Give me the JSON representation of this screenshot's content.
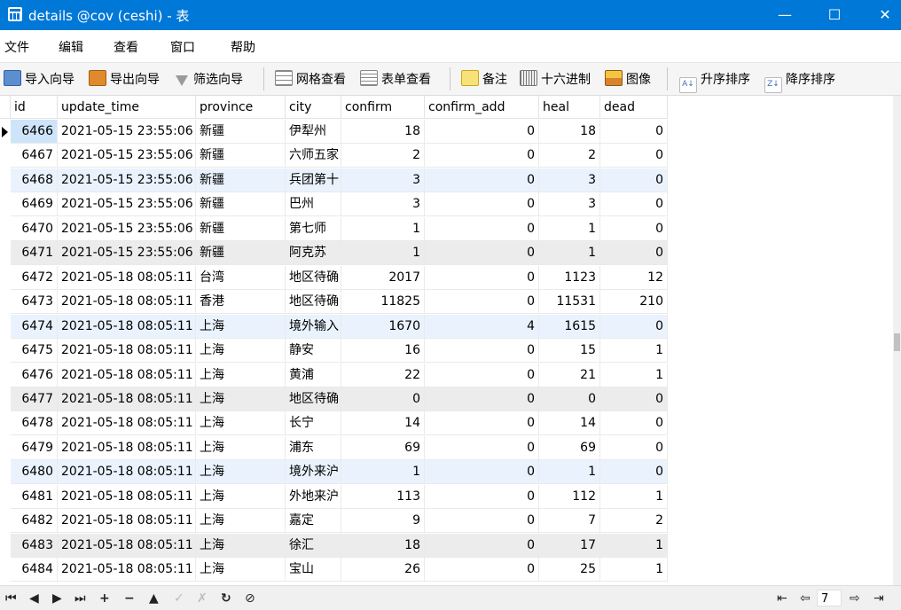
{
  "window": {
    "title": "details @cov (ceshi) - 表",
    "minimize": "—",
    "maximize": "☐",
    "close": "✕"
  },
  "menu": [
    "文件",
    "编辑",
    "查看",
    "窗口",
    "帮助"
  ],
  "toolbar": {
    "import_wizard": "导入向导",
    "export_wizard": "导出向导",
    "filter_wizard": "筛选向导",
    "grid_view": "网格查看",
    "form_view": "表单查看",
    "memo": "备注",
    "hex": "十六进制",
    "image": "图像",
    "sort_asc": "升序排序",
    "sort_desc": "降序排序"
  },
  "table": {
    "columns": [
      "id",
      "update_time",
      "province",
      "city",
      "confirm",
      "confirm_add",
      "heal",
      "dead"
    ],
    "rows": [
      [
        "6466",
        "2021-05-15 23:55:06",
        "新疆",
        "伊犁州",
        "18",
        "0",
        "18",
        "0"
      ],
      [
        "6467",
        "2021-05-15 23:55:06",
        "新疆",
        "六师五家",
        "2",
        "0",
        "2",
        "0"
      ],
      [
        "6468",
        "2021-05-15 23:55:06",
        "新疆",
        "兵团第十",
        "3",
        "0",
        "3",
        "0"
      ],
      [
        "6469",
        "2021-05-15 23:55:06",
        "新疆",
        "巴州",
        "3",
        "0",
        "3",
        "0"
      ],
      [
        "6470",
        "2021-05-15 23:55:06",
        "新疆",
        "第七师",
        "1",
        "0",
        "1",
        "0"
      ],
      [
        "6471",
        "2021-05-15 23:55:06",
        "新疆",
        "阿克苏",
        "1",
        "0",
        "1",
        "0"
      ],
      [
        "6472",
        "2021-05-18 08:05:11",
        "台湾",
        "地区待确",
        "2017",
        "0",
        "1123",
        "12"
      ],
      [
        "6473",
        "2021-05-18 08:05:11",
        "香港",
        "地区待确",
        "11825",
        "0",
        "11531",
        "210"
      ],
      [
        "6474",
        "2021-05-18 08:05:11",
        "上海",
        "境外输入",
        "1670",
        "4",
        "1615",
        "0"
      ],
      [
        "6475",
        "2021-05-18 08:05:11",
        "上海",
        "静安",
        "16",
        "0",
        "15",
        "1"
      ],
      [
        "6476",
        "2021-05-18 08:05:11",
        "上海",
        "黄浦",
        "22",
        "0",
        "21",
        "1"
      ],
      [
        "6477",
        "2021-05-18 08:05:11",
        "上海",
        "地区待确",
        "0",
        "0",
        "0",
        "0"
      ],
      [
        "6478",
        "2021-05-18 08:05:11",
        "上海",
        "长宁",
        "14",
        "0",
        "14",
        "0"
      ],
      [
        "6479",
        "2021-05-18 08:05:11",
        "上海",
        "浦东",
        "69",
        "0",
        "69",
        "0"
      ],
      [
        "6480",
        "2021-05-18 08:05:11",
        "上海",
        "境外来沪",
        "1",
        "0",
        "1",
        "0"
      ],
      [
        "6481",
        "2021-05-18 08:05:11",
        "上海",
        "外地来沪",
        "113",
        "0",
        "112",
        "1"
      ],
      [
        "6482",
        "2021-05-18 08:05:11",
        "上海",
        "嘉定",
        "9",
        "0",
        "7",
        "2"
      ],
      [
        "6483",
        "2021-05-18 08:05:11",
        "上海",
        "徐汇",
        "18",
        "0",
        "17",
        "1"
      ],
      [
        "6484",
        "2021-05-18 08:05:11",
        "上海",
        "宝山",
        "26",
        "0",
        "25",
        "1"
      ]
    ],
    "selected_row": 0,
    "highlighted_rows": [
      2,
      8,
      14
    ],
    "shaded_rows": [
      5,
      11,
      17
    ],
    "colors": {
      "selected": "#cde4fb",
      "highlight": "#eaf3fd",
      "shaded": "#ececec"
    }
  },
  "statusbar": {
    "first": "⏮",
    "prev": "◀",
    "next": "▶",
    "last": "⏭",
    "add": "+",
    "delete": "−",
    "up": "▲",
    "apply": "✓",
    "discard": "✗",
    "refresh": "↻",
    "stop": "⊘",
    "page_first": "⇤",
    "page_prev": "⇦",
    "page": "7",
    "page_next": "⇨",
    "page_last": "⇥"
  }
}
